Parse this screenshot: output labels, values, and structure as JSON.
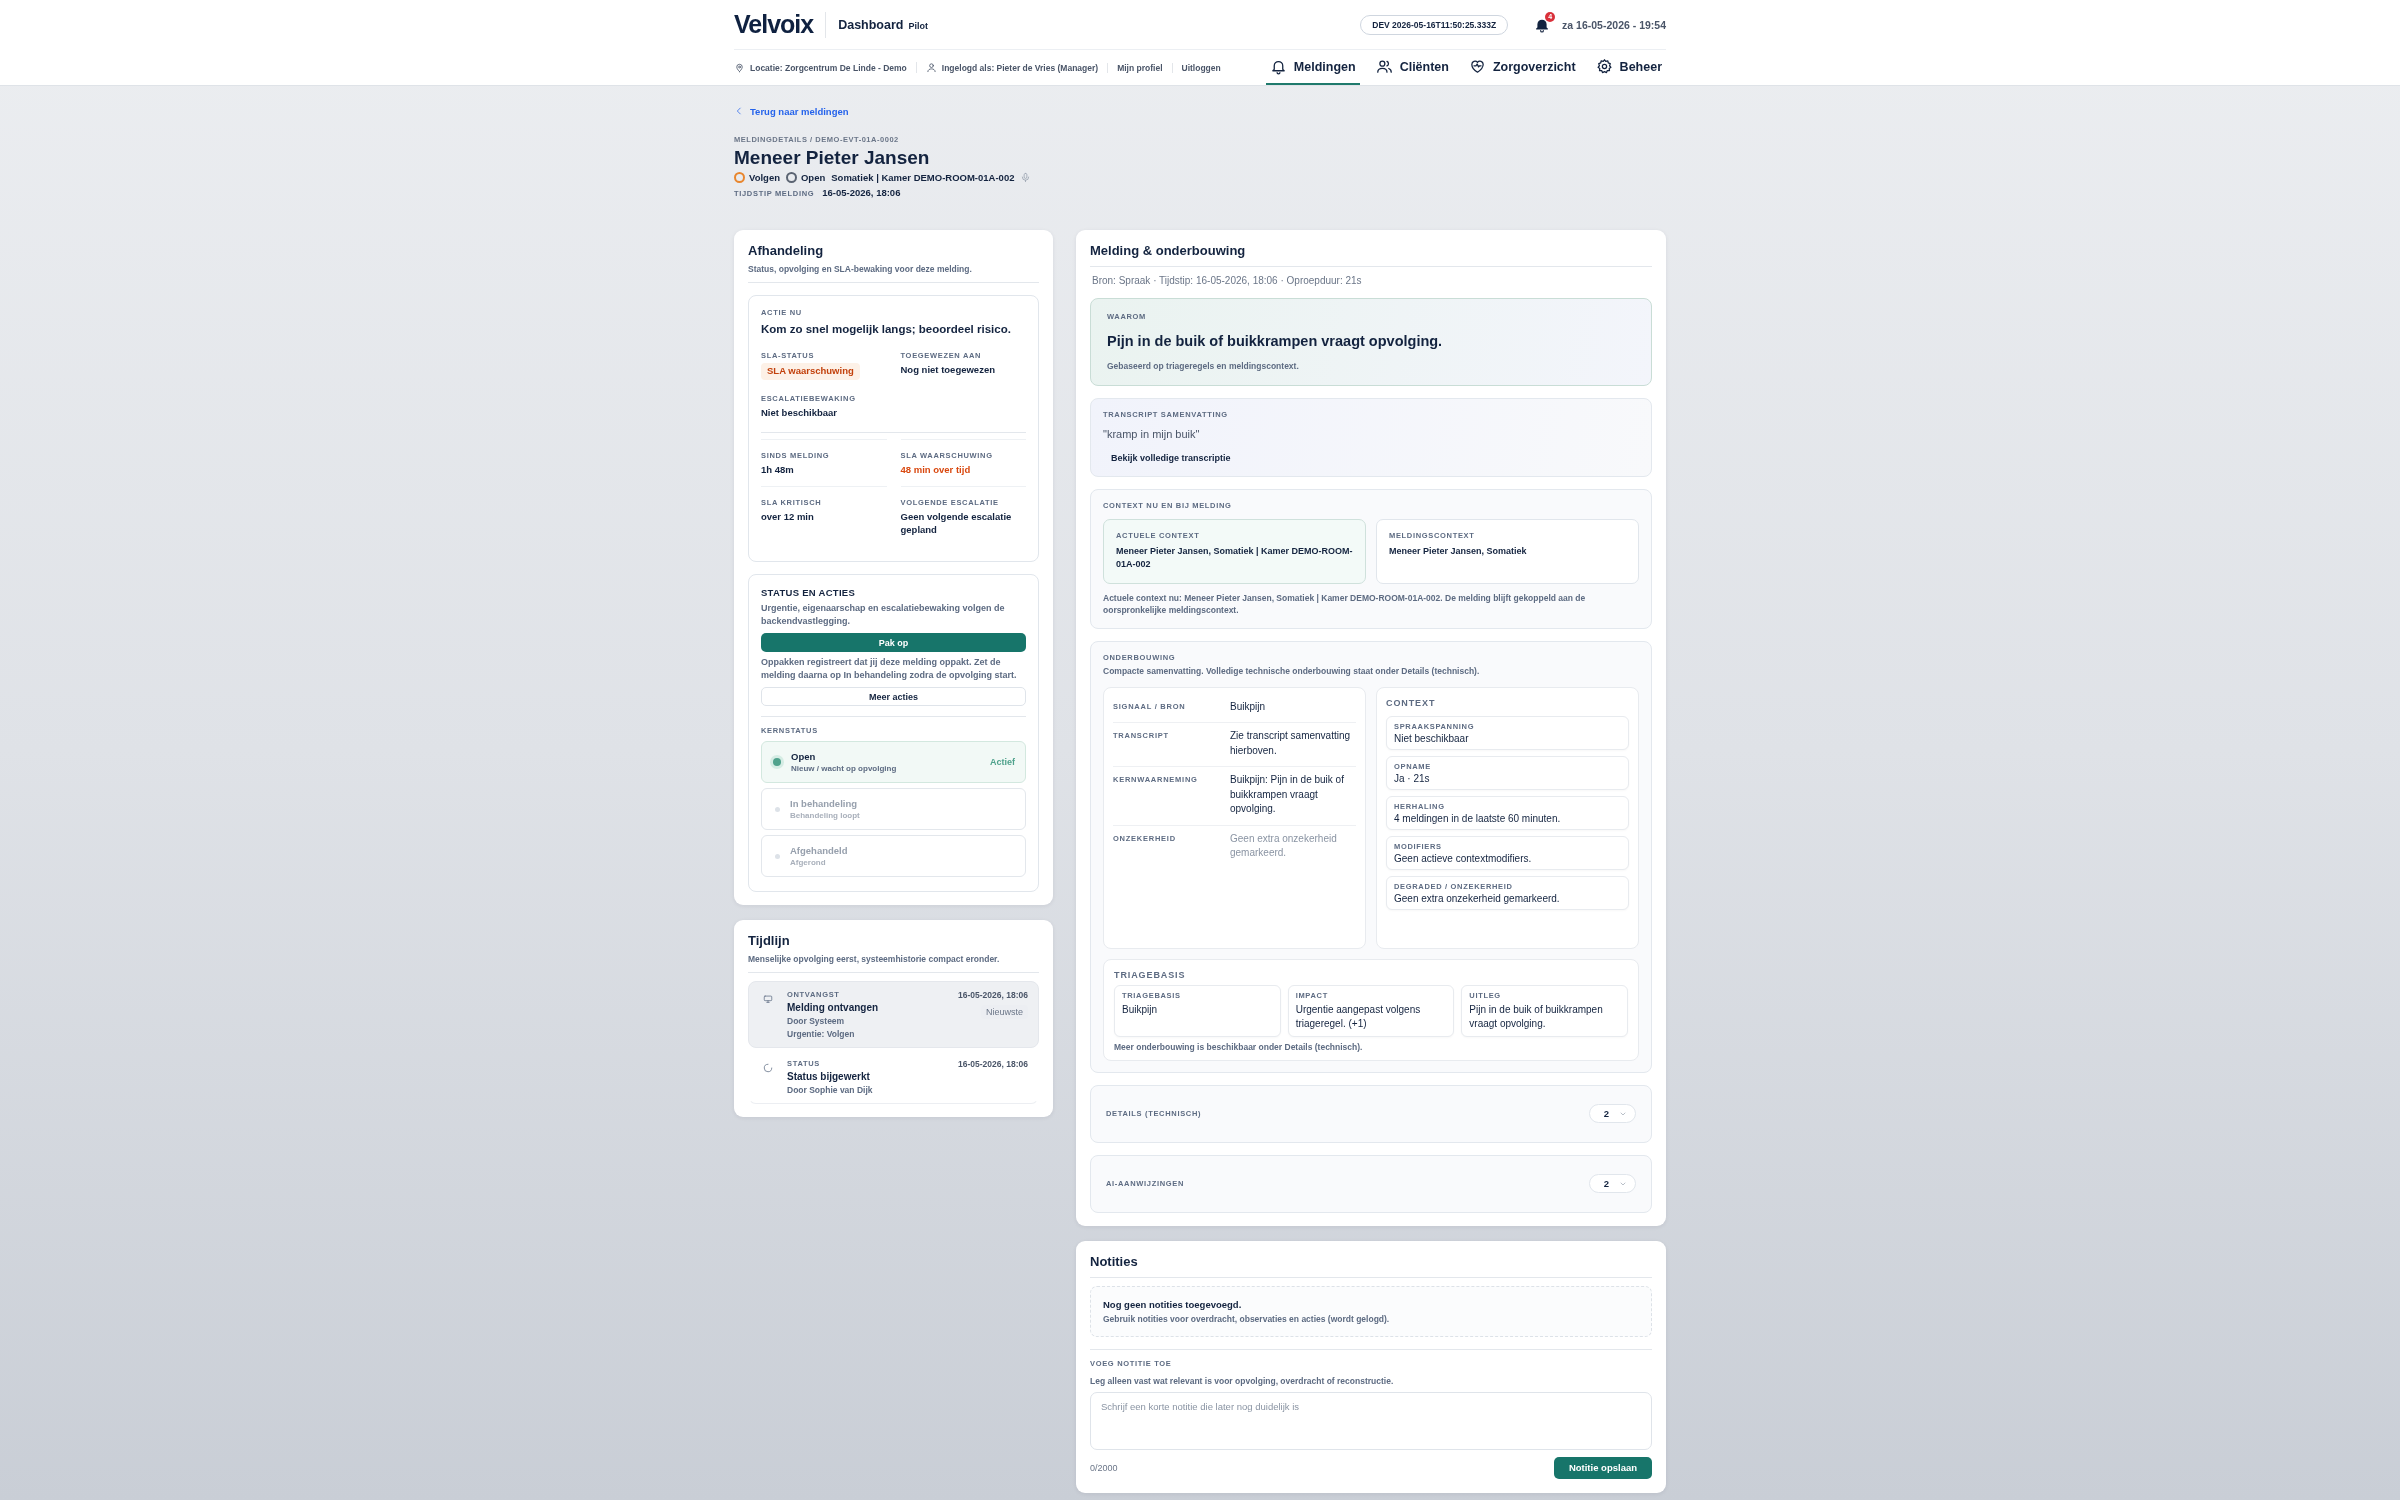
{
  "header": {
    "logo": "Velvoix",
    "app_title": "Dashboard",
    "app_badge": "Pilot",
    "env_badge": "DEV 2026-05-16T11:50:25.333Z",
    "notification_count": "4",
    "datetime": "za 16-05-2026 - 19:54",
    "meta": [
      {
        "kind": "location",
        "text": "Locatie: Zorgcentrum De Linde - Demo"
      },
      {
        "kind": "user",
        "text": "Ingelogd als: Pieter de Vries (Manager)"
      },
      {
        "kind": "link",
        "text": "Mijn profiel"
      },
      {
        "kind": "link",
        "text": "Uitloggen"
      }
    ],
    "nav": [
      {
        "label": "Meldingen",
        "selected": true
      },
      {
        "label": "Cliënten",
        "selected": false
      },
      {
        "label": "Zorgoverzicht",
        "selected": false
      },
      {
        "label": "Beheer",
        "selected": false
      }
    ]
  },
  "detail": {
    "back_link": "Terug naar meldingen",
    "breadcrumb": "MELDINGDETAILS / DEMO-EVT-01A-0002",
    "title": "Meneer Pieter Jansen",
    "tags": [
      {
        "label": "Volgen",
        "color": "#e8862e"
      },
      {
        "label": "Open",
        "color": "#5b6472"
      }
    ],
    "location": "Somatiek | Kamer DEMO-ROOM-01A-002",
    "time_label": "TIJDSTIP MELDING",
    "time": "16-05-2026, 18:06"
  },
  "handling": {
    "title": "Afhandeling",
    "subtitle": "Status, opvolging en SLA-bewaking voor deze melding.",
    "action_label": "ACTIE NU",
    "action": "Kom zo snel mogelijk langs; beoordeel risico.",
    "fields": [
      {
        "label": "SLA-STATUS",
        "value": "SLA waarschuwing",
        "kind": "badge"
      },
      {
        "label": "TOEGEWEZEN AAN",
        "value": "Nog niet toegewezen",
        "kind": "plain"
      },
      {
        "label": "ESCALATIEBEWAKING",
        "value": "Niet beschikbaar",
        "kind": "plain"
      }
    ],
    "timers": [
      {
        "label": "SINDS MELDING",
        "value": "1h 48m",
        "kind": "plain"
      },
      {
        "label": "SLA WAARSCHUWING",
        "value": "48 min over tijd",
        "kind": "warning"
      },
      {
        "label": "SLA KRITISCH",
        "value": "over 12 min",
        "kind": "plain"
      },
      {
        "label": "VOLGENDE ESCALATIE",
        "value": "Geen volgende escalatie gepland",
        "kind": "plain"
      }
    ],
    "status_title": "STATUS EN ACTIES",
    "status_text": "Urgentie, eigenaarschap en escalatiebewaking volgen de backendvastlegging.",
    "primary_button": "Pak op",
    "hint": "Oppakken registreert dat jij deze melding oppakt. Zet de melding daarna op In behandeling zodra de opvolging start.",
    "secondary_button": "Meer acties",
    "core_label": "KERNSTATUS",
    "core": [
      {
        "title": "Open",
        "subtitle": "Nieuw / wacht op opvolging",
        "active_label": "Actief",
        "selected": true
      },
      {
        "title": "In behandeling",
        "subtitle": "Behandeling loopt",
        "selected": false
      },
      {
        "title": "Afgehandeld",
        "subtitle": "Afgerond",
        "selected": false
      }
    ]
  },
  "timeline": {
    "title": "Tijdlijn",
    "subtitle": "Menselijke opvolging eerst, systeemhistorie compact eronder.",
    "events": [
      {
        "category": "ONTVANGST",
        "title": "Melding ontvangen",
        "lines": [
          "Door Systeem",
          "Urgentie: Volgen"
        ],
        "time": "16-05-2026, 18:06",
        "badge": "Nieuwste",
        "highlighted": true
      },
      {
        "category": "STATUS",
        "title": "Status bijgewerkt",
        "lines": [
          "Door Sophie van Dijk"
        ],
        "time": "16-05-2026, 18:06",
        "highlighted": false
      }
    ]
  },
  "report": {
    "title": "Melding & onderbouwing",
    "meta": "Bron: Spraak · Tijdstip: 16-05-2026, 18:06 · Oproepduur: 21s",
    "why": {
      "label": "WAAROM",
      "text": "Pijn in de buik of buikkrampen vraagt opvolging.",
      "note": "Gebaseerd op triageregels en meldingscontext."
    },
    "transcript": {
      "label": "TRANSCRIPT SAMENVATTING",
      "quote": "\"kramp in mijn buik\"",
      "link": "Bekijk volledige transcriptie"
    },
    "context": {
      "label": "CONTEXT NU EN BIJ MELDING",
      "cards": [
        {
          "label": "ACTUELE CONTEXT",
          "value": "Meneer Pieter Jansen, Somatiek | Kamer DEMO-ROOM-01A-002",
          "highlighted": true
        },
        {
          "label": "MELDINGSCONTEXT",
          "value": "Meneer Pieter Jansen, Somatiek",
          "highlighted": false
        }
      ],
      "note": "Actuele context nu: Meneer Pieter Jansen, Somatiek | Kamer DEMO-ROOM-01A-002. De melding blijft gekoppeld aan de oorspronkelijke meldingscontext."
    },
    "basis": {
      "label": "ONDERBOUWING",
      "summary": "Compacte samenvatting. Volledige technische onderbouwing staat onder Details (technisch).",
      "rows": [
        {
          "label": "SIGNAAL / BRON",
          "value": "Buikpijn",
          "muted": false
        },
        {
          "label": "TRANSCRIPT",
          "value": "Zie transcript samenvatting hierboven.",
          "muted": false
        },
        {
          "label": "KERNWAARNEMING",
          "value": "Buikpijn: Pijn in de buik of buikkrampen vraagt opvolging.",
          "muted": false
        },
        {
          "label": "ONZEKERHEID",
          "value": "Geen extra onzekerheid gemarkeerd.",
          "muted": true
        }
      ],
      "context_title": "CONTEXT",
      "context_items": [
        {
          "label": "SPRAAKSPANNING",
          "value": "Niet beschikbaar"
        },
        {
          "label": "OPNAME",
          "value": "Ja · 21s"
        },
        {
          "label": "HERHALING",
          "value": "4 meldingen in de laatste 60 minuten."
        },
        {
          "label": "MODIFIERS",
          "value": "Geen actieve contextmodifiers."
        },
        {
          "label": "DEGRADED / ONZEKERHEID",
          "value": "Geen extra onzekerheid gemarkeerd."
        }
      ],
      "triage_title": "TRIAGEBASIS",
      "triage": [
        {
          "label": "TRIAGEBASIS",
          "value": "Buikpijn"
        },
        {
          "label": "IMPACT",
          "value": "Urgentie aangepast volgens triageregel. (+1)"
        },
        {
          "label": "UITLEG",
          "value": "Pijn in de buik of buikkrampen vraagt opvolging."
        }
      ],
      "footer": "Meer onderbouwing is beschikbaar onder Details (technisch)."
    },
    "sections": [
      {
        "label": "DETAILS (TECHNISCH)",
        "count": "2"
      },
      {
        "label": "AI-AANWIJZINGEN",
        "count": "2"
      }
    ]
  },
  "notes": {
    "title": "Notities",
    "empty_title": "Nog geen notities toegevoegd.",
    "empty_text": "Gebruik notities voor overdracht, observaties en acties (wordt gelogd).",
    "add_label": "VOEG NOTITIE TOE",
    "add_hint": "Leg alleen vast wat relevant is voor opvolging, overdracht of reconstructie.",
    "placeholder": "Schrijf een korte notitie die later nog duidelijk is",
    "counter": "0/2000",
    "save_button": "Notitie opslaan"
  }
}
